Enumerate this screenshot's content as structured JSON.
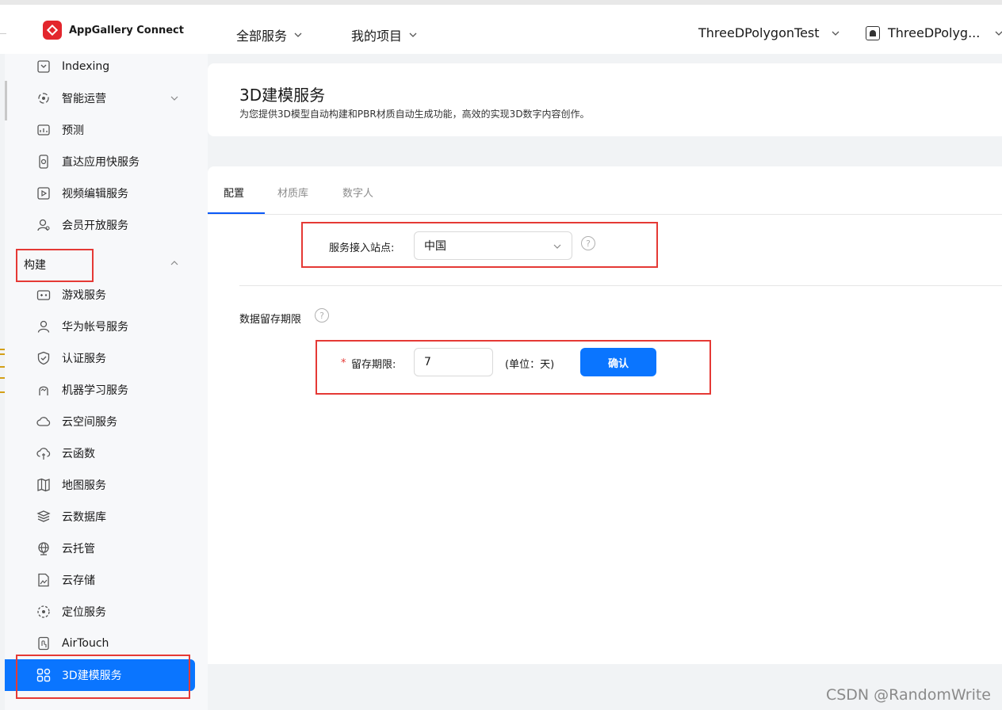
{
  "topbar": {
    "brand": "AppGallery Connect",
    "nav": [
      "全部服务",
      "我的项目"
    ],
    "project": "ThreeDPolygonTest",
    "app": "ThreeDPolyg..."
  },
  "sidebar": {
    "items_top": [
      {
        "label": "Indexing",
        "icon": "index-icon"
      },
      {
        "label": "智能运营",
        "icon": "operations-icon"
      },
      {
        "label": "预测",
        "icon": "predict-icon"
      },
      {
        "label": "直达应用快服务",
        "icon": "quick-service-icon"
      },
      {
        "label": "视频编辑服务",
        "icon": "video-edit-icon"
      },
      {
        "label": "会员开放服务",
        "icon": "member-icon"
      }
    ],
    "section": "构建",
    "items_build": [
      {
        "label": "游戏服务",
        "icon": "gamepad-icon"
      },
      {
        "label": "华为帐号服务",
        "icon": "user-icon"
      },
      {
        "label": "认证服务",
        "icon": "shield-icon"
      },
      {
        "label": "机器学习服务",
        "icon": "ml-icon"
      },
      {
        "label": "云空间服务",
        "icon": "cloud-space-icon"
      },
      {
        "label": "云函数",
        "icon": "cloud-function-icon"
      },
      {
        "label": "地图服务",
        "icon": "map-icon"
      },
      {
        "label": "云数据库",
        "icon": "database-icon"
      },
      {
        "label": "云托管",
        "icon": "globe-icon"
      },
      {
        "label": "云存储",
        "icon": "storage-icon"
      },
      {
        "label": "定位服务",
        "icon": "location-icon"
      },
      {
        "label": "AirTouch",
        "icon": "airtouch-icon"
      }
    ],
    "active": {
      "label": "3D建模服务",
      "icon": "grid-icon"
    }
  },
  "header": {
    "title": "3D建模服务",
    "desc": "为您提供3D模型自动构建和PBR材质自动生成功能，高效的实现3D数字内容创作。"
  },
  "tabs": [
    "配置",
    "材质库",
    "数字人"
  ],
  "form": {
    "site_label": "服务接入站点:",
    "site_value": "中国",
    "retention_section": "数据留存期限",
    "required_mark": "*",
    "retention_label": "留存期限:",
    "retention_value": "7",
    "unit": "(单位：天)",
    "confirm": "确认"
  },
  "watermark": "CSDN @RandomWrite",
  "colors": {
    "accent": "#0a75ff",
    "brand_red": "#e3262d",
    "annotation_red": "#e53935"
  }
}
